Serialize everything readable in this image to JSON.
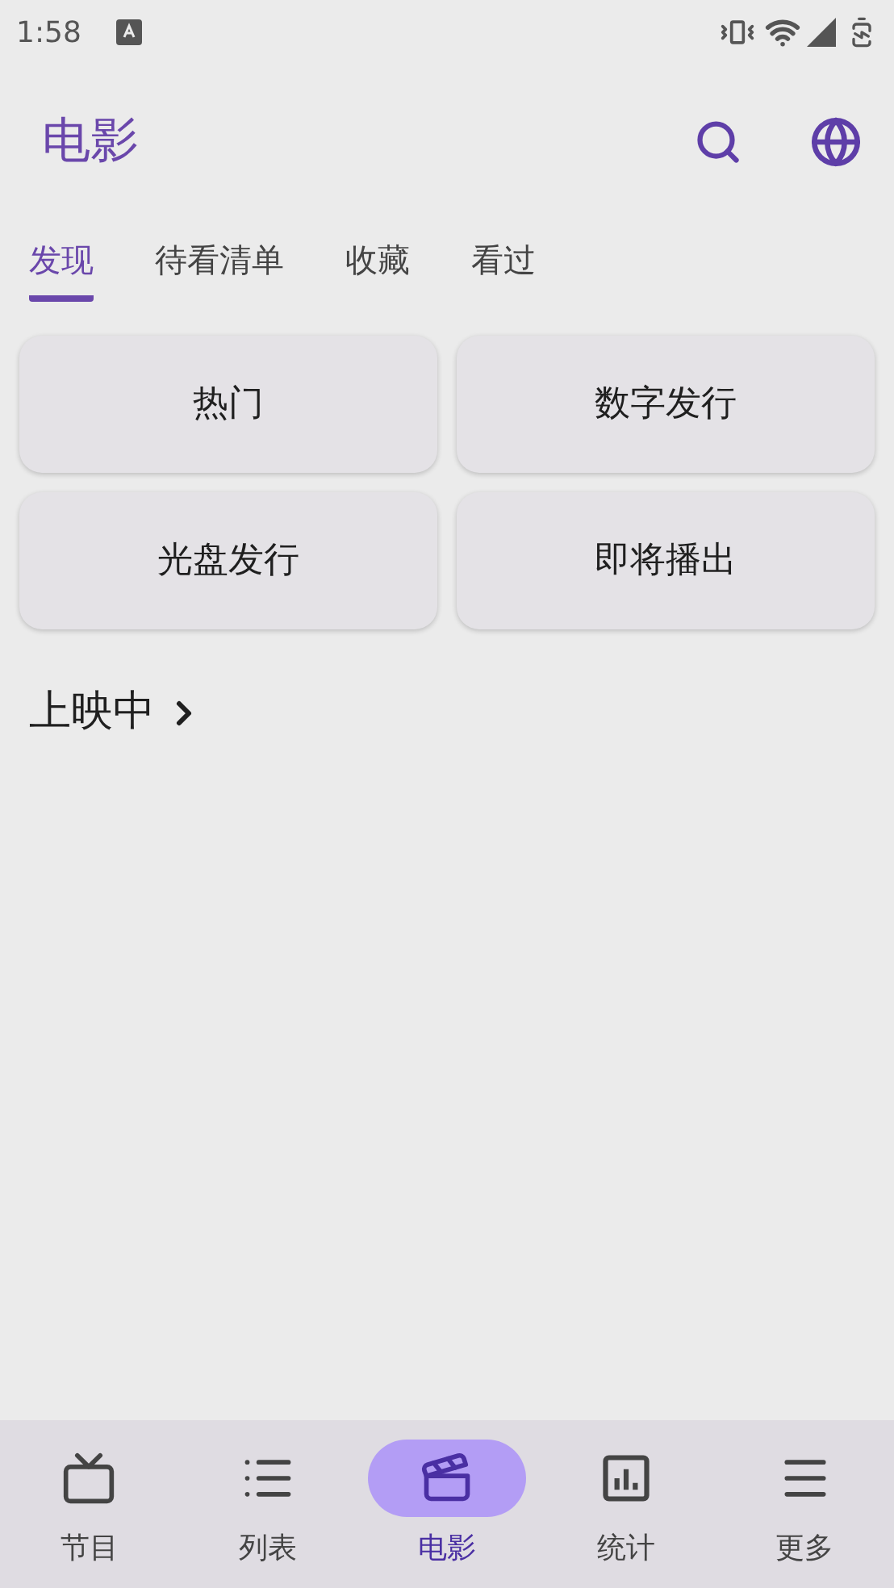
{
  "status_bar": {
    "time": "1:58"
  },
  "app_bar": {
    "title": "电影"
  },
  "tabs": [
    {
      "label": "发现",
      "selected": true
    },
    {
      "label": "待看清单",
      "selected": false
    },
    {
      "label": "收藏",
      "selected": false
    },
    {
      "label": "看过",
      "selected": false
    }
  ],
  "categories": [
    "热门",
    "数字发行",
    "光盘发行",
    "即将播出"
  ],
  "section": {
    "title": "上映中"
  },
  "bottom_nav": [
    {
      "label": "节目",
      "kind": "tv",
      "selected": false
    },
    {
      "label": "列表",
      "kind": "list",
      "selected": false
    },
    {
      "label": "电影",
      "kind": "movie",
      "selected": true
    },
    {
      "label": "统计",
      "kind": "stats",
      "selected": false
    },
    {
      "label": "更多",
      "kind": "more",
      "selected": false
    }
  ]
}
